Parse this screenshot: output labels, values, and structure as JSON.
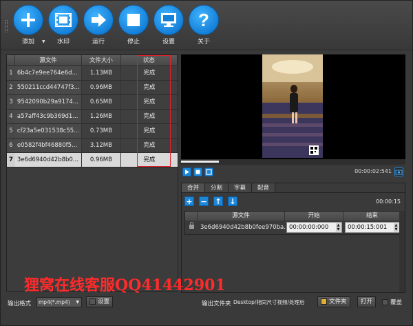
{
  "toolbar": {
    "buttons": [
      {
        "label": "添加",
        "icon": "plus-icon"
      },
      {
        "label": "水印",
        "icon": "film-icon"
      },
      {
        "label": "运行",
        "icon": "arrow-right-icon"
      },
      {
        "label": "停止",
        "icon": "stop-icon"
      },
      {
        "label": "设置",
        "icon": "monitor-icon"
      },
      {
        "label": "关于",
        "icon": "question-icon"
      }
    ]
  },
  "file_table": {
    "headers": {
      "source": "源文件",
      "size": "文件大小",
      "status": "状态"
    },
    "rows": [
      {
        "idx": "1",
        "source": "6b4c7e9ee764e6d...",
        "size": "1.13MB",
        "status": "完成"
      },
      {
        "idx": "2",
        "source": "550211ccd44747f3...",
        "size": "0.96MB",
        "status": "完成"
      },
      {
        "idx": "3",
        "source": "9542090b29a9174...",
        "size": "0.65MB",
        "status": "完成"
      },
      {
        "idx": "4",
        "source": "a57aff43c9b369d1...",
        "size": "1.26MB",
        "status": "完成"
      },
      {
        "idx": "5",
        "source": "cf23a5e031538c55...",
        "size": "0.73MB",
        "status": "完成"
      },
      {
        "idx": "6",
        "source": "e0582f4bf46880f5...",
        "size": "3.12MB",
        "status": "完成"
      },
      {
        "idx": "7",
        "source": "3e6d6940d42b8b0...",
        "size": "0.96MB",
        "status": "完成"
      }
    ]
  },
  "preview": {
    "time": "00:00:02:541",
    "progress_fraction": 0.17
  },
  "tabs": [
    "合并",
    "分割",
    "字幕",
    "配音"
  ],
  "segments": {
    "total_time": "00:00:15",
    "headers": {
      "file": "源文件",
      "start": "开始",
      "end": "结束"
    },
    "rows": [
      {
        "file": "3e6d6940d42b8b0fee970ba...",
        "start": "00:00:00:000",
        "end": "00:00:15:001"
      }
    ]
  },
  "overlay_text": "狸窝在线客服QQ41442901",
  "bottom": {
    "format_label": "输出格式",
    "format_value": "mp4(*.mp4)",
    "settings_label": "设置",
    "folder_label": "输出文件夹",
    "folder_path": "Desktop/相同尺寸视频/处理后",
    "folder_button": "文件夹",
    "open_button": "打开",
    "overwrite_label": "覆盖"
  },
  "colors": {
    "accent": "#1d86d6",
    "highlight_box": "#e0202a",
    "overlay_text": "#ff2b2b"
  }
}
